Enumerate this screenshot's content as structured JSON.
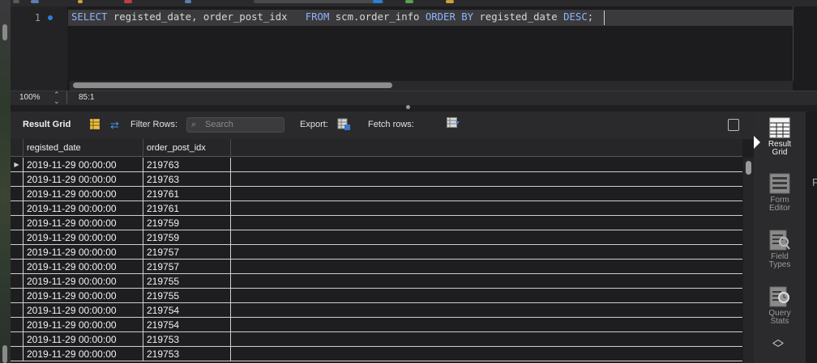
{
  "editor": {
    "line_number": "1",
    "sql": {
      "t1": "SELECT",
      "t2": " registed_date, order_post_idx   ",
      "t3": "FROM",
      "t4": " scm.order_info ",
      "t5": "ORDER BY",
      "t6": " registed_date ",
      "t7": "DESC",
      "t8": ";"
    }
  },
  "statusbar": {
    "zoom": "100%",
    "cursor_position": "85:1"
  },
  "results_toolbar": {
    "result_grid_label": "Result Grid",
    "filter_rows_label": "Filter Rows:",
    "search_placeholder": "Search",
    "export_label": "Export:",
    "fetch_rows_label": "Fetch rows:"
  },
  "grid": {
    "columns": [
      "registed_date",
      "order_post_idx"
    ],
    "rows": [
      [
        "2019-11-29 00:00:00",
        "219763"
      ],
      [
        "2019-11-29 00:00:00",
        "219763"
      ],
      [
        "2019-11-29 00:00:00",
        "219761"
      ],
      [
        "2019-11-29 00:00:00",
        "219761"
      ],
      [
        "2019-11-29 00:00:00",
        "219759"
      ],
      [
        "2019-11-29 00:00:00",
        "219759"
      ],
      [
        "2019-11-29 00:00:00",
        "219757"
      ],
      [
        "2019-11-29 00:00:00",
        "219757"
      ],
      [
        "2019-11-29 00:00:00",
        "219755"
      ],
      [
        "2019-11-29 00:00:00",
        "219755"
      ],
      [
        "2019-11-29 00:00:00",
        "219754"
      ],
      [
        "2019-11-29 00:00:00",
        "219754"
      ],
      [
        "2019-11-29 00:00:00",
        "219753"
      ],
      [
        "2019-11-29 00:00:00",
        "219753"
      ]
    ],
    "current_row_marker": "▶"
  },
  "side_panel": {
    "items": [
      {
        "line1": "Result",
        "line2": "Grid"
      },
      {
        "line1": "Form",
        "line2": "Editor"
      },
      {
        "line1": "Field",
        "line2": "Types"
      },
      {
        "line1": "Query",
        "line2": "Stats"
      }
    ],
    "edge_letter": "F"
  },
  "colors": {
    "keyword": "#8fb3ff",
    "accent_blue": "#2c7ed6",
    "background": "#1f1f21"
  }
}
